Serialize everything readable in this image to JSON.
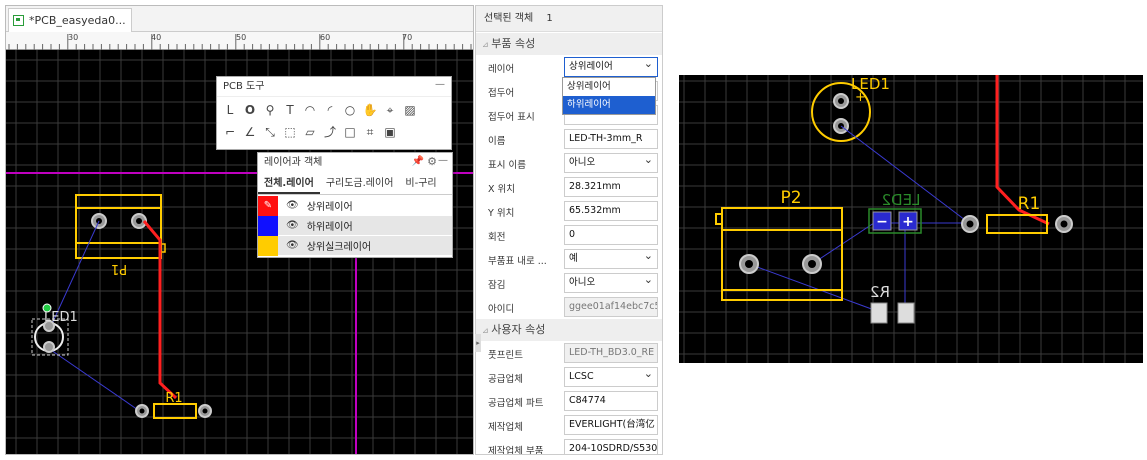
{
  "editor": {
    "tab_title": "*PCB_easyeda0...",
    "ruler_labels": [
      "30",
      "40",
      "50",
      "60",
      "70"
    ]
  },
  "pcb_tools": {
    "title": "PCB 도구",
    "minimize": "—",
    "row1_icons": [
      "route-track-icon",
      "pad-icon",
      "via-icon",
      "text-icon",
      "arc-icon",
      "arc2-icon",
      "circle-icon",
      "hand-icon",
      "cross-icon",
      "image-icon"
    ],
    "row2_icons": [
      "line-icon",
      "angle-icon",
      "dimension-icon",
      "rect-select-icon",
      "solid-region-icon",
      "connect-icon",
      "rectangle-icon",
      "ruler-icon",
      "copper-area-icon"
    ]
  },
  "layers_panel": {
    "title": "레이어과 객체",
    "tabs": [
      "전체.레이어",
      "구리도금.레이어",
      "비-구리"
    ],
    "layers": [
      {
        "name": "상위레이어",
        "color": "#ff1010"
      },
      {
        "name": "하위레이어",
        "color": "#1010ff"
      },
      {
        "name": "상위실크레이어",
        "color": "#ffcc00"
      }
    ]
  },
  "properties": {
    "selected_label": "선택된 객체",
    "selected_count": "1",
    "part_section": "부품 속성",
    "custom_section": "사용자 속성",
    "rows": [
      {
        "label": "레이어",
        "value": "상위레이어"
      },
      {
        "label": "접두어",
        "value": ""
      },
      {
        "label": "접두어 표시",
        "value": ""
      },
      {
        "label": "이름",
        "value": "LED-TH-3mm_R"
      },
      {
        "label": "표시 이름",
        "value": "아니오"
      },
      {
        "label": "X 위치",
        "value": "28.321mm"
      },
      {
        "label": "Y 위치",
        "value": "65.532mm"
      },
      {
        "label": "회전",
        "value": "0"
      },
      {
        "label": "부품표 내로 ...",
        "value": "예"
      },
      {
        "label": "잠김",
        "value": "아니오"
      },
      {
        "label": "아이디",
        "value": "ggee01af14ebc7c5c"
      }
    ],
    "custom_rows": [
      {
        "label": "풋프린트",
        "value": "LED-TH_BD3.0_RE"
      },
      {
        "label": "공급업체",
        "value": "LCSC"
      },
      {
        "label": "공급업체 파트",
        "value": "C84774"
      },
      {
        "label": "제작업체",
        "value": "EVERLIGHT(台湾亿"
      },
      {
        "label": "제작업체 부품",
        "value": "204-10SDRD/S530-"
      }
    ],
    "layer_options": [
      "상위레이어",
      "하위레이어"
    ]
  },
  "canvas_left": {
    "labels": {
      "led": "LED1",
      "r1": "R1",
      "p1": "P1"
    }
  },
  "canvas_right": {
    "labels": {
      "led1": "LED1",
      "led2": "LED2",
      "p2": "P2",
      "r1": "R1",
      "r2": "R2"
    }
  },
  "colors": {
    "silk": "#ffcc00",
    "track": "#ff2020",
    "pad": "#b0b0b0",
    "ratsnest": "#3a3ad0",
    "grid": "#333333",
    "bottom_silk": "#2a8a2a",
    "board_edge": "#cc00cc"
  }
}
